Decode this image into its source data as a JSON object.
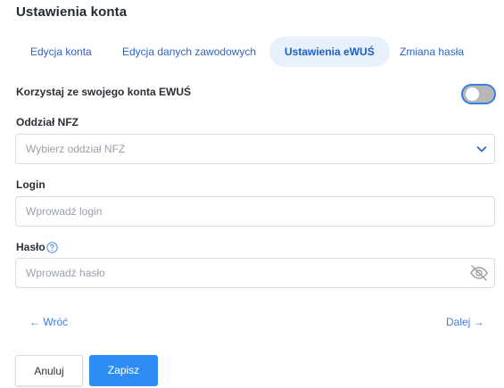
{
  "page": {
    "title": "Ustawienia konta"
  },
  "tabs": [
    {
      "label": "Edycja konta",
      "active": false
    },
    {
      "label": "Edycja danych zawodowych",
      "active": false
    },
    {
      "label": "Ustawienia eWUŚ",
      "active": true
    },
    {
      "label": "Zmiana hasła",
      "active": false
    }
  ],
  "toggle": {
    "label": "Korzystaj ze swojego konta EWUŚ",
    "on": false
  },
  "nfz": {
    "label": "Oddział NFZ",
    "placeholder": "Wybierz oddział NFZ"
  },
  "login": {
    "label": "Login",
    "placeholder": "Wprowadź login"
  },
  "password": {
    "label": "Hasło",
    "placeholder": "Wprowadź hasło"
  },
  "nav": {
    "back": "← Wróć",
    "next": "Dalej →"
  },
  "buttons": {
    "cancel": "Anuluj",
    "save": "Zapisz"
  },
  "colors": {
    "accent": "#2e8df2",
    "link": "#2d63c7",
    "tab_active_bg": "#e7f1fb"
  },
  "icons": {
    "help": "question-circle-icon",
    "eye": "eye-off-icon",
    "select": "chevron-down-icon"
  }
}
